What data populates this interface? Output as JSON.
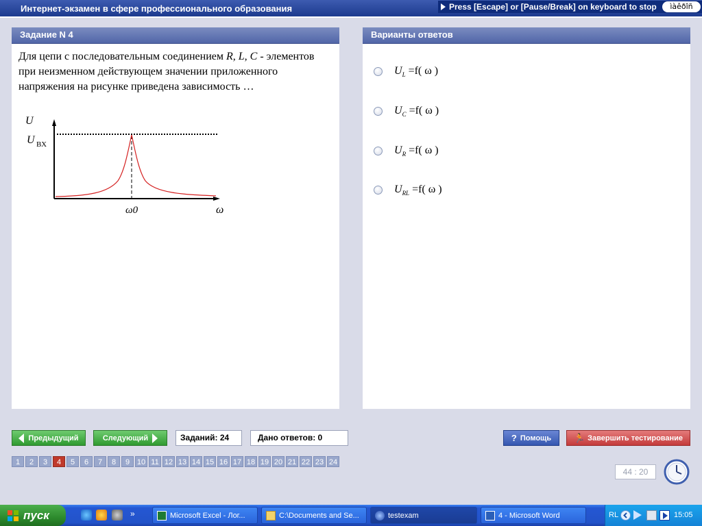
{
  "window": {
    "title": "Интернет-экзамен в сфере профессионального образования",
    "escape_hint": "Press [Escape] or [Pause/Break] on keyboard to stop",
    "lang_indicator": "ìàêðîñ"
  },
  "question": {
    "header": "Задание N 4",
    "text_parts": [
      "Для цепи с последовательным соединением ",
      "R, L, C",
      " - элементов при неизменном действующем значении приложенного напряжения на рисунке приведена  зависимость …"
    ],
    "graph": {
      "y_label": "U",
      "input_label": "U",
      "input_subscript": "ВХ",
      "x_label": "ω",
      "peak_label": "ω0"
    }
  },
  "answers": {
    "header": "Варианты ответов",
    "options": [
      {
        "u": "U",
        "sub": "L",
        "rest": " =f( ω )"
      },
      {
        "u": "U",
        "sub": "C",
        "rest": " =f( ω )"
      },
      {
        "u": "U",
        "sub": "R",
        "rest": " =f( ω )"
      },
      {
        "u": "U",
        "sub": "RL",
        "rest": " =f( ω )"
      }
    ]
  },
  "controls": {
    "prev_label": "Предыдущий",
    "next_label": "Следующий",
    "tasks_label": "Заданий: 24",
    "answered_label": "Дано ответов: 0",
    "help_label": "Помощь",
    "finish_label": "Завершить тестирование",
    "timer": "44 : 20",
    "current_page": 4,
    "pages": [
      "1",
      "2",
      "3",
      "4",
      "5",
      "6",
      "7",
      "8",
      "9",
      "10",
      "11",
      "12",
      "13",
      "14",
      "15",
      "16",
      "17",
      "18",
      "19",
      "20",
      "21",
      "22",
      "23",
      "24"
    ]
  },
  "taskbar": {
    "start_label": "пуск",
    "quick_more": "»",
    "items": [
      {
        "label": "Microsoft Excel - Лог...",
        "icon": "excel-icon"
      },
      {
        "label": "C:\\Documents and Se...",
        "icon": "folder-icon"
      },
      {
        "label": "testexam",
        "icon": "testexam-icon"
      },
      {
        "label": "4 - Microsoft Word",
        "icon": "word-icon"
      }
    ],
    "tray_lang": "RL",
    "clock": "15:05"
  },
  "colors": {
    "title_bar": "#1c3a8e",
    "panel_header": "#5e72b0",
    "graph_curve": "#d42020",
    "nav_green": "#2f9a30",
    "help_blue": "#3557b0",
    "finish_red": "#c43b3b",
    "current_page": "#c0392b"
  }
}
